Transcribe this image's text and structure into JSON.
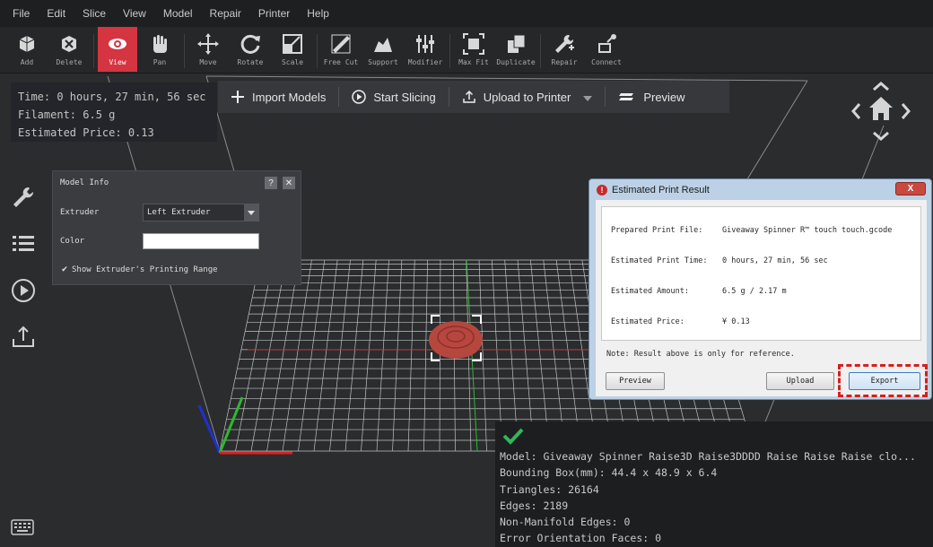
{
  "menu": [
    "File",
    "Edit",
    "Slice",
    "View",
    "Model",
    "Repair",
    "Printer",
    "Help"
  ],
  "toolbar": [
    {
      "label": "Add",
      "icon": "add-model-icon"
    },
    {
      "label": "Delete",
      "icon": "delete-model-icon"
    },
    {
      "label": "View",
      "icon": "eye-icon",
      "active": true
    },
    {
      "label": "Pan",
      "icon": "hand-icon"
    },
    {
      "label": "Move",
      "icon": "move-icon"
    },
    {
      "label": "Rotate",
      "icon": "rotate-icon"
    },
    {
      "label": "Scale",
      "icon": "scale-icon"
    },
    {
      "label": "Free Cut",
      "icon": "cut-icon"
    },
    {
      "label": "Support",
      "icon": "support-icon"
    },
    {
      "label": "Modifier",
      "icon": "modifier-icon"
    },
    {
      "label": "Max Fit",
      "icon": "max-fit-icon"
    },
    {
      "label": "Duplicate",
      "icon": "duplicate-icon"
    },
    {
      "label": "Repair",
      "icon": "repair-icon"
    },
    {
      "label": "Connect",
      "icon": "connect-icon"
    }
  ],
  "print_stats": {
    "time": "Time: 0 hours, 27 min, 56 sec",
    "filament": "Filament: 6.5 g",
    "price": "Estimated Price: 0.13"
  },
  "action_bar": {
    "import": "Import Models",
    "slice": "Start Slicing",
    "upload": "Upload to Printer",
    "preview": "Preview"
  },
  "model_info": {
    "title": "Model Info",
    "help": "?",
    "close": "✕",
    "extruder_label": "Extruder",
    "extruder_value": "Left Extruder",
    "color_label": "Color",
    "color_value": "#ffffff",
    "range_label": "Show Extruder's Printing Range",
    "range_checked": true
  },
  "dialog": {
    "title": "Estimated Print Result",
    "close": "X",
    "rows": [
      {
        "label": "Prepared Print File:",
        "value": "Giveaway Spinner R™ touch touch.gcode"
      },
      {
        "label": "Estimated Print Time:",
        "value": "0 hours, 27 min, 56 sec"
      },
      {
        "label": "Estimated Amount:",
        "value": "6.5 g / 2.17 m"
      },
      {
        "label": "Estimated Price:",
        "value": "¥ 0.13"
      }
    ],
    "note": "Note: Result above is only for reference.",
    "preview_button": "Preview",
    "upload_button": "Upload",
    "export_button": "Export"
  },
  "model_stats": {
    "model": "Model: Giveaway Spinner Raise3D Raise3DDDD Raise Raise Raise clo...",
    "bounding_box": "Bounding Box(mm): 44.4 x 48.9 x 6.4",
    "triangles": "Triangles: 26164",
    "edges": "Edges: 2189",
    "non_manifold": "Non-Manifold Edges: 0",
    "error_faces": "Error Orientation Faces: 0"
  },
  "colors": {
    "accent": "#d43540",
    "model": "#b5473f",
    "axis_x": "#e02020",
    "axis_y": "#2fb82f",
    "axis_z": "#2030d0"
  }
}
